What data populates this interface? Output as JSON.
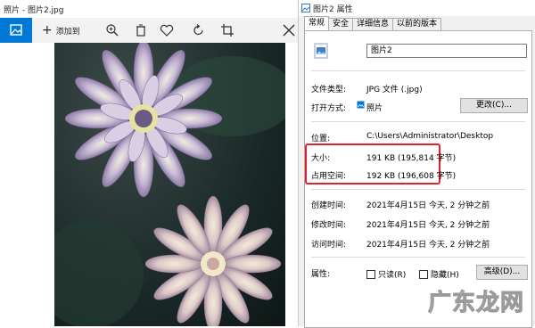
{
  "photos_app": {
    "title": "照片 - 图片2.jpg",
    "add_label": "添加到",
    "toolbar_icons": [
      "zoom-in-icon",
      "delete-icon",
      "heart-icon",
      "rotate-icon",
      "crop-icon",
      "edit-icon"
    ]
  },
  "properties": {
    "title": "图片2 属性",
    "tabs": [
      "常规",
      "安全",
      "详细信息",
      "以前的版本"
    ],
    "name_value": "图片2",
    "rows": {
      "file_type": {
        "label": "文件类型:",
        "value": "JPG 文件 (.jpg)"
      },
      "opens_with": {
        "label": "打开方式:",
        "value": "照片"
      },
      "location": {
        "label": "位置:",
        "value": "C:\\Users\\Administrator\\Desktop"
      },
      "size": {
        "label": "大小:",
        "value": "191 KB (195,814 字节)"
      },
      "size_on_disk": {
        "label": "占用空间:",
        "value": "192 KB (196,608 字节)"
      },
      "created": {
        "label": "创建时间:",
        "value": "2021年4月15日 今天, 2 分钟之前"
      },
      "modified": {
        "label": "修改时间:",
        "value": "2021年4月15日 今天, 2 分钟之前"
      },
      "accessed": {
        "label": "访问时间:",
        "value": "2021年4月15日 今天, 2 分钟之前"
      },
      "attributes": {
        "label": "属性:"
      }
    },
    "change_button": "更改(C)...",
    "readonly_label": "只读(R)",
    "hidden_label": "隐藏(H)",
    "advanced_button": "高级(D)..."
  },
  "watermark": "广东龙网",
  "colors": {
    "accent": "#0078d7",
    "highlight": "#e0212b"
  }
}
